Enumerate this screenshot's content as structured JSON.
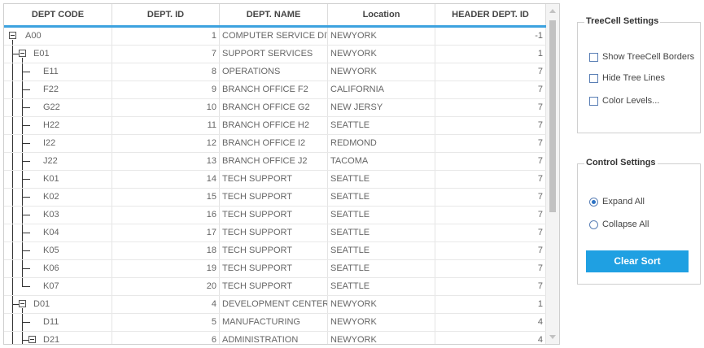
{
  "grid": {
    "columns": [
      "DEPT CODE",
      "DEPT. ID",
      "DEPT. NAME",
      "Location",
      "HEADER DEPT. ID"
    ],
    "rows": [
      {
        "code": "A00",
        "id": "1",
        "name": "COMPUTER SERVICE DIV.",
        "loc": "NEWYORK",
        "hid": "-1"
      },
      {
        "code": "E01",
        "id": "7",
        "name": "SUPPORT SERVICES",
        "loc": "NEWYORK",
        "hid": "1"
      },
      {
        "code": "E11",
        "id": "8",
        "name": "OPERATIONS",
        "loc": "NEWYORK",
        "hid": "7"
      },
      {
        "code": "F22",
        "id": "9",
        "name": "BRANCH OFFICE F2",
        "loc": "CALIFORNIA",
        "hid": "7"
      },
      {
        "code": "G22",
        "id": "10",
        "name": "BRANCH OFFICE G2",
        "loc": "NEW JERSY",
        "hid": "7"
      },
      {
        "code": "H22",
        "id": "11",
        "name": "BRANCH OFFICE H2",
        "loc": "SEATTLE",
        "hid": "7"
      },
      {
        "code": "I22",
        "id": "12",
        "name": "BRANCH OFFICE I2",
        "loc": "REDMOND",
        "hid": "7"
      },
      {
        "code": "J22",
        "id": "13",
        "name": "BRANCH OFFICE J2",
        "loc": "TACOMA",
        "hid": "7"
      },
      {
        "code": "K01",
        "id": "14",
        "name": "TECH SUPPORT",
        "loc": "SEATTLE",
        "hid": "7"
      },
      {
        "code": "K02",
        "id": "15",
        "name": "TECH SUPPORT",
        "loc": "SEATTLE",
        "hid": "7"
      },
      {
        "code": "K03",
        "id": "16",
        "name": "TECH SUPPORT",
        "loc": "SEATTLE",
        "hid": "7"
      },
      {
        "code": "K04",
        "id": "17",
        "name": "TECH SUPPORT",
        "loc": "SEATTLE",
        "hid": "7"
      },
      {
        "code": "K05",
        "id": "18",
        "name": "TECH SUPPORT",
        "loc": "SEATTLE",
        "hid": "7"
      },
      {
        "code": "K06",
        "id": "19",
        "name": "TECH SUPPORT",
        "loc": "SEATTLE",
        "hid": "7"
      },
      {
        "code": "K07",
        "id": "20",
        "name": "TECH SUPPORT",
        "loc": "SEATTLE",
        "hid": "7"
      },
      {
        "code": "D01",
        "id": "4",
        "name": "DEVELOPMENT CENTER",
        "loc": "NEWYORK",
        "hid": "1"
      },
      {
        "code": "D11",
        "id": "5",
        "name": "MANUFACTURING",
        "loc": "NEWYORK",
        "hid": "4"
      },
      {
        "code": "D21",
        "id": "6",
        "name": "ADMINISTRATION",
        "loc": "NEWYORK",
        "hid": "4"
      }
    ]
  },
  "treecell_settings": {
    "title": "TreeCell Settings",
    "show_borders": "Show TreeCell Borders",
    "hide_lines": "Hide Tree Lines",
    "color_levels": "Color Levels..."
  },
  "control_settings": {
    "title": "Control Settings",
    "expand_all": "Expand All",
    "collapse_all": "Collapse All",
    "clear_sort": "Clear Sort"
  }
}
